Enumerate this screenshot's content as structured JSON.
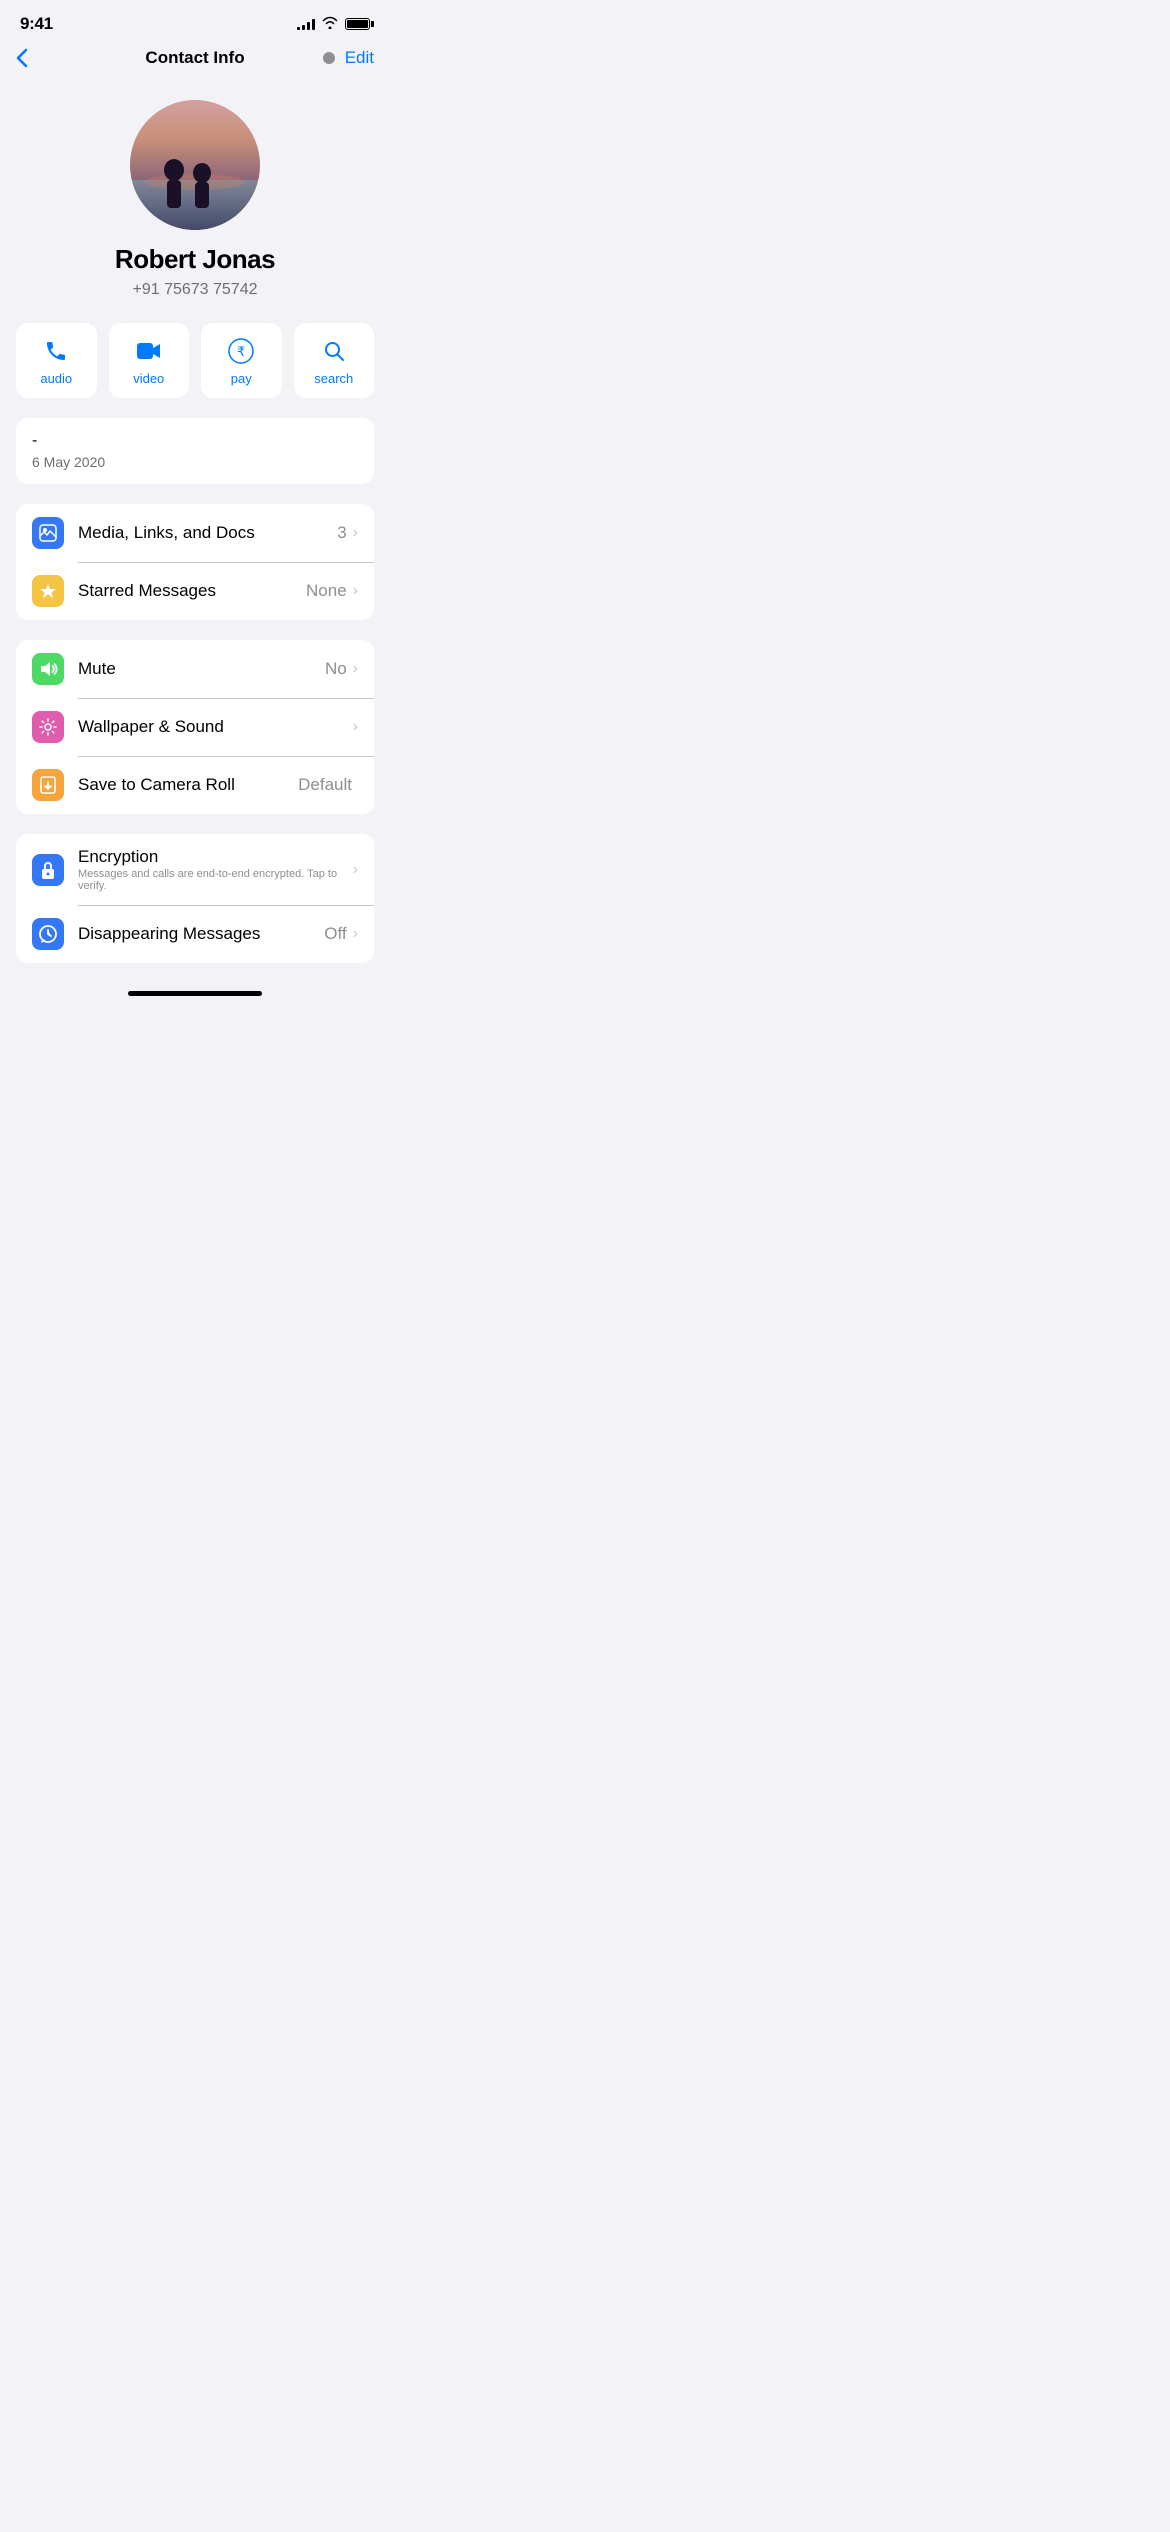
{
  "statusBar": {
    "time": "9:41",
    "signalBars": [
      3,
      5,
      7,
      9,
      11
    ],
    "batteryFull": true
  },
  "nav": {
    "backLabel": "",
    "title": "Contact Info",
    "editLabel": "Edit"
  },
  "profile": {
    "name": "Robert Jonas",
    "phone": "+91 75673 75742"
  },
  "actionButtons": [
    {
      "id": "audio",
      "label": "audio",
      "icon": "📞"
    },
    {
      "id": "video",
      "label": "video",
      "icon": "📹"
    },
    {
      "id": "pay",
      "label": "pay",
      "icon": "₹"
    },
    {
      "id": "search",
      "label": "search",
      "icon": "🔍"
    }
  ],
  "infoCard": {
    "dash": "-",
    "date": "6 May 2020"
  },
  "section1": {
    "rows": [
      {
        "id": "media-links-docs",
        "iconClass": "blue",
        "iconUnicode": "🖼️",
        "label": "Media, Links, and Docs",
        "value": "3",
        "hasChevron": true
      },
      {
        "id": "starred-messages",
        "iconClass": "yellow",
        "iconUnicode": "⭐",
        "label": "Starred Messages",
        "value": "None",
        "hasChevron": true
      }
    ]
  },
  "section2": {
    "rows": [
      {
        "id": "mute",
        "iconClass": "green",
        "iconUnicode": "🔊",
        "label": "Mute",
        "value": "No",
        "hasChevron": true
      },
      {
        "id": "wallpaper-sound",
        "iconClass": "pink",
        "iconUnicode": "✿",
        "label": "Wallpaper & Sound",
        "value": "",
        "hasChevron": true
      },
      {
        "id": "save-camera-roll",
        "iconClass": "orange",
        "iconUnicode": "⬇",
        "label": "Save to Camera Roll",
        "value": "Default",
        "hasChevron": false
      }
    ]
  },
  "section3": {
    "rows": [
      {
        "id": "encryption",
        "iconClass": "blue",
        "iconUnicode": "🔒",
        "label": "Encryption",
        "sublabel": "Messages and calls are end-to-end encrypted. Tap to verify.",
        "value": "",
        "hasChevron": true
      },
      {
        "id": "disappearing-messages",
        "iconClass": "blue",
        "iconUnicode": "⏰",
        "label": "Disappearing Messages",
        "sublabel": "",
        "value": "Off",
        "hasChevron": true
      }
    ]
  }
}
